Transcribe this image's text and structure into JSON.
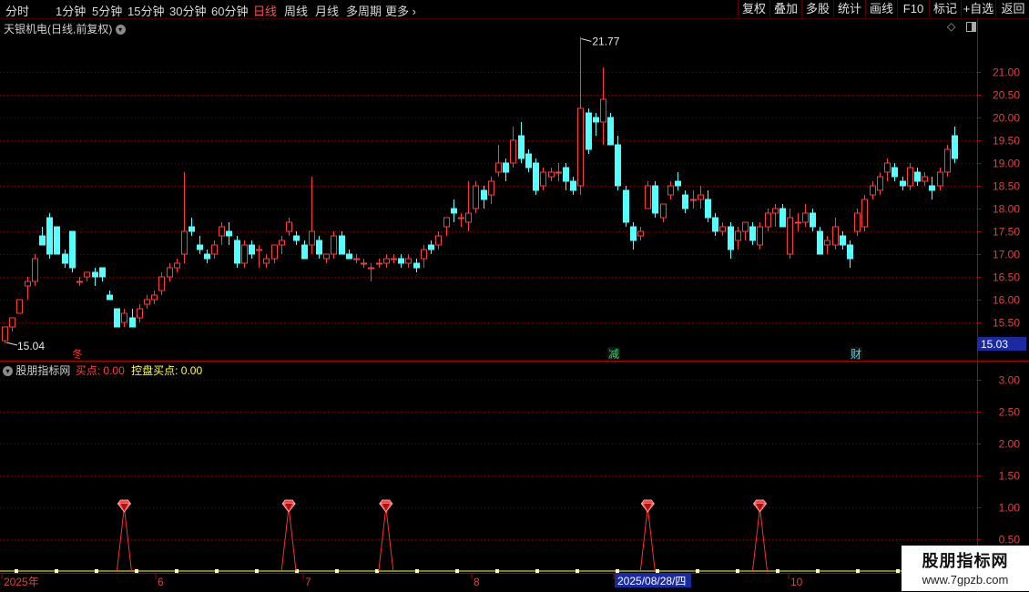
{
  "toolbar": {
    "timeframes": [
      {
        "label": "分时",
        "active": false
      },
      {
        "label": "1分钟",
        "active": false
      },
      {
        "label": "5分钟",
        "active": false
      },
      {
        "label": "15分钟",
        "active": false
      },
      {
        "label": "30分钟",
        "active": false
      },
      {
        "label": "60分钟",
        "active": false
      },
      {
        "label": "日线",
        "active": true
      },
      {
        "label": "周线",
        "active": false
      },
      {
        "label": "月线",
        "active": false
      },
      {
        "label": "多周期",
        "active": false
      },
      {
        "label": "更多",
        "active": false
      }
    ],
    "right_buttons": [
      "复权",
      "叠加",
      "多股",
      "统计",
      "画线",
      "F10",
      "标记",
      "+自选",
      "返回"
    ]
  },
  "main_panel": {
    "title": "天银机电(日线,前复权)",
    "high_label": "21.77",
    "low_label": "15.04",
    "current_price": "15.03",
    "y_ticks": [
      "21.00",
      "20.50",
      "20.00",
      "19.50",
      "19.00",
      "18.50",
      "18.00",
      "17.50",
      "17.00",
      "16.50",
      "16.00",
      "15.50",
      "15.00"
    ],
    "event_markers": [
      {
        "text": "冬",
        "color": "#ff3030"
      },
      {
        "text": "减",
        "color": "#30d070"
      },
      {
        "text": "财",
        "color": "#60c8ff"
      }
    ]
  },
  "indicator_panel": {
    "name": "股朋指标网",
    "line1_label": "买点:",
    "line1_value": "0.00",
    "line2_label": "控盘买点:",
    "line2_value": "0.00",
    "y_ticks": [
      "3.00",
      "2.50",
      "2.00",
      "1.50",
      "1.00",
      "0.50"
    ]
  },
  "time_axis": {
    "labels": [
      "2025年",
      "6",
      "7",
      "8",
      "9",
      "10"
    ],
    "cursor_date": "2025/08/28/四"
  },
  "watermark": {
    "title": "股朋指标网",
    "url": "www.7gpzb.com"
  },
  "colors": {
    "up": "#ff3b3b",
    "down": "#54ffff",
    "grid": "#7a0000",
    "axis": "#b00000"
  },
  "chart_data": {
    "type": "candlestick",
    "y_range": [
      14.9,
      22.3
    ],
    "candles": [
      [
        15.1,
        15.4,
        15.04,
        15.4
      ],
      [
        15.4,
        15.6,
        15.3,
        15.6
      ],
      [
        15.7,
        16.0,
        15.7,
        16.0
      ],
      [
        16.3,
        16.5,
        16.0,
        16.4
      ],
      [
        16.4,
        17.0,
        16.3,
        16.9
      ],
      [
        17.4,
        17.6,
        17.2,
        17.2
      ],
      [
        17.8,
        17.9,
        16.9,
        17.0
      ],
      [
        17.6,
        17.6,
        17.0,
        17.0
      ],
      [
        17.0,
        17.1,
        16.7,
        16.8
      ],
      [
        17.5,
        17.5,
        16.6,
        16.7
      ],
      [
        16.4,
        16.5,
        16.3,
        16.4
      ],
      [
        16.5,
        16.6,
        16.4,
        16.6
      ],
      [
        16.6,
        16.7,
        16.3,
        16.5
      ],
      [
        16.7,
        16.7,
        16.4,
        16.5
      ],
      [
        16.1,
        16.2,
        16.0,
        16.0
      ],
      [
        15.8,
        15.8,
        15.5,
        15.4
      ],
      [
        15.5,
        15.8,
        15.4,
        15.7
      ],
      [
        15.6,
        15.8,
        15.5,
        15.4
      ],
      [
        15.6,
        15.9,
        15.5,
        15.8
      ],
      [
        15.9,
        16.1,
        15.8,
        16.0
      ],
      [
        16.0,
        16.2,
        15.9,
        16.1
      ],
      [
        16.2,
        16.6,
        16.1,
        16.5
      ],
      [
        16.5,
        16.8,
        16.4,
        16.7
      ],
      [
        16.7,
        16.9,
        16.6,
        16.8
      ],
      [
        17.0,
        18.8,
        16.8,
        17.5
      ],
      [
        17.6,
        17.8,
        17.4,
        17.5
      ],
      [
        17.2,
        17.4,
        17.0,
        17.1
      ],
      [
        17.0,
        17.1,
        16.8,
        16.9
      ],
      [
        17.0,
        17.3,
        16.9,
        17.2
      ],
      [
        17.4,
        17.7,
        17.2,
        17.6
      ],
      [
        17.5,
        17.7,
        17.2,
        17.4
      ],
      [
        17.3,
        17.4,
        16.7,
        16.8
      ],
      [
        16.8,
        17.3,
        16.7,
        17.2
      ],
      [
        17.2,
        17.3,
        16.9,
        17.0
      ],
      [
        17.1,
        17.2,
        16.7,
        17.1
      ],
      [
        16.8,
        17.0,
        16.7,
        16.9
      ],
      [
        16.9,
        17.1,
        16.8,
        17.2
      ],
      [
        17.2,
        17.4,
        17.0,
        17.3
      ],
      [
        17.5,
        17.8,
        17.4,
        17.7
      ],
      [
        17.4,
        17.5,
        17.2,
        17.3
      ],
      [
        17.2,
        17.3,
        16.9,
        16.9
      ],
      [
        17.2,
        18.7,
        17.0,
        17.5
      ],
      [
        17.3,
        17.4,
        16.9,
        17.0
      ],
      [
        16.9,
        17.0,
        16.8,
        17.0
      ],
      [
        17.0,
        17.5,
        16.9,
        17.4
      ],
      [
        17.4,
        17.5,
        17.1,
        17.0
      ],
      [
        17.0,
        17.1,
        16.9,
        16.9
      ],
      [
        16.9,
        17.0,
        16.8,
        16.9
      ],
      [
        16.8,
        16.9,
        16.7,
        16.8
      ],
      [
        16.7,
        16.8,
        16.4,
        16.7
      ],
      [
        16.8,
        16.9,
        16.7,
        16.8
      ],
      [
        16.8,
        17.0,
        16.7,
        16.9
      ],
      [
        16.9,
        17.0,
        16.8,
        16.9
      ],
      [
        16.9,
        17.0,
        16.7,
        16.8
      ],
      [
        16.8,
        17.0,
        16.7,
        16.9
      ],
      [
        16.8,
        16.9,
        16.6,
        16.7
      ],
      [
        16.9,
        17.2,
        16.7,
        17.1
      ],
      [
        17.2,
        17.3,
        17.0,
        17.1
      ],
      [
        17.2,
        17.5,
        17.1,
        17.4
      ],
      [
        17.6,
        17.8,
        17.4,
        17.8
      ],
      [
        18.0,
        18.2,
        17.7,
        17.9
      ],
      [
        17.8,
        17.9,
        17.6,
        17.8
      ],
      [
        17.7,
        18.6,
        17.5,
        17.9
      ],
      [
        18.0,
        18.6,
        17.9,
        18.5
      ],
      [
        18.4,
        18.5,
        18.0,
        18.2
      ],
      [
        18.3,
        18.7,
        18.1,
        18.6
      ],
      [
        18.8,
        19.4,
        18.7,
        19.0
      ],
      [
        19.0,
        19.1,
        18.6,
        18.8
      ],
      [
        19.0,
        19.8,
        18.9,
        19.5
      ],
      [
        19.6,
        19.9,
        19.0,
        19.1
      ],
      [
        19.2,
        19.3,
        18.8,
        18.9
      ],
      [
        19.0,
        19.1,
        18.3,
        18.4
      ],
      [
        18.5,
        18.9,
        18.4,
        18.8
      ],
      [
        18.7,
        18.9,
        18.6,
        18.8
      ],
      [
        18.8,
        19.0,
        18.6,
        18.8
      ],
      [
        18.9,
        19.0,
        18.4,
        18.6
      ],
      [
        18.6,
        18.7,
        18.3,
        18.4
      ],
      [
        18.5,
        21.77,
        18.3,
        20.2
      ],
      [
        20.1,
        20.2,
        19.2,
        19.3
      ],
      [
        20.0,
        20.1,
        19.6,
        19.9
      ],
      [
        19.9,
        21.1,
        19.4,
        20.4
      ],
      [
        20.0,
        20.1,
        19.4,
        19.4
      ],
      [
        19.4,
        19.6,
        18.4,
        18.5
      ],
      [
        18.4,
        18.5,
        17.6,
        17.7
      ],
      [
        17.6,
        17.7,
        17.1,
        17.3
      ],
      [
        17.4,
        17.6,
        17.3,
        17.5
      ],
      [
        18.0,
        18.6,
        18.0,
        18.5
      ],
      [
        18.5,
        18.6,
        17.8,
        17.9
      ],
      [
        17.8,
        18.1,
        17.7,
        18.1
      ],
      [
        18.3,
        18.6,
        18.2,
        18.5
      ],
      [
        18.6,
        18.8,
        18.4,
        18.5
      ],
      [
        18.3,
        18.4,
        17.9,
        18.0
      ],
      [
        18.2,
        18.4,
        18.0,
        18.2
      ],
      [
        18.2,
        18.5,
        18.0,
        18.3
      ],
      [
        18.2,
        18.4,
        17.7,
        17.8
      ],
      [
        17.8,
        17.9,
        17.4,
        17.5
      ],
      [
        17.5,
        17.7,
        17.4,
        17.6
      ],
      [
        17.6,
        17.7,
        16.9,
        17.1
      ],
      [
        17.3,
        17.6,
        17.1,
        17.5
      ],
      [
        17.5,
        17.7,
        17.3,
        17.7
      ],
      [
        17.6,
        17.7,
        17.2,
        17.3
      ],
      [
        17.2,
        17.7,
        17.1,
        17.6
      ],
      [
        17.6,
        18.0,
        17.5,
        17.9
      ],
      [
        17.9,
        18.1,
        17.6,
        18.0
      ],
      [
        18.0,
        18.1,
        17.6,
        17.6
      ],
      [
        17.0,
        18.0,
        16.9,
        17.8
      ],
      [
        17.7,
        17.9,
        17.5,
        17.7
      ],
      [
        17.7,
        18.1,
        17.6,
        17.9
      ],
      [
        17.9,
        18.0,
        17.5,
        17.6
      ],
      [
        17.5,
        17.6,
        17.0,
        17.0
      ],
      [
        17.2,
        17.4,
        17.0,
        17.3
      ],
      [
        17.2,
        17.8,
        17.1,
        17.6
      ],
      [
        17.4,
        17.5,
        17.1,
        17.2
      ],
      [
        17.2,
        17.3,
        16.7,
        16.9
      ],
      [
        17.5,
        18.0,
        17.4,
        17.9
      ],
      [
        17.6,
        18.3,
        17.5,
        18.2
      ],
      [
        18.3,
        18.6,
        18.2,
        18.5
      ],
      [
        18.4,
        18.8,
        18.3,
        18.7
      ],
      [
        18.8,
        19.1,
        18.6,
        19.0
      ],
      [
        18.9,
        19.0,
        18.6,
        18.7
      ],
      [
        18.6,
        18.7,
        18.4,
        18.5
      ],
      [
        18.5,
        19.0,
        18.4,
        18.9
      ],
      [
        18.8,
        18.9,
        18.5,
        18.6
      ],
      [
        18.6,
        18.8,
        18.5,
        18.7
      ],
      [
        18.5,
        18.7,
        18.2,
        18.4
      ],
      [
        18.5,
        18.9,
        18.4,
        18.8
      ],
      [
        18.8,
        19.4,
        18.7,
        19.3
      ],
      [
        19.6,
        19.8,
        19.0,
        19.1
      ]
    ],
    "indicator_signals": [
      {
        "index": 16,
        "value": 1.0
      },
      {
        "index": 38,
        "value": 1.0
      },
      {
        "index": 51,
        "value": 1.0
      },
      {
        "index": 86,
        "value": 1.0
      },
      {
        "index": 101,
        "value": 1.0
      }
    ]
  }
}
